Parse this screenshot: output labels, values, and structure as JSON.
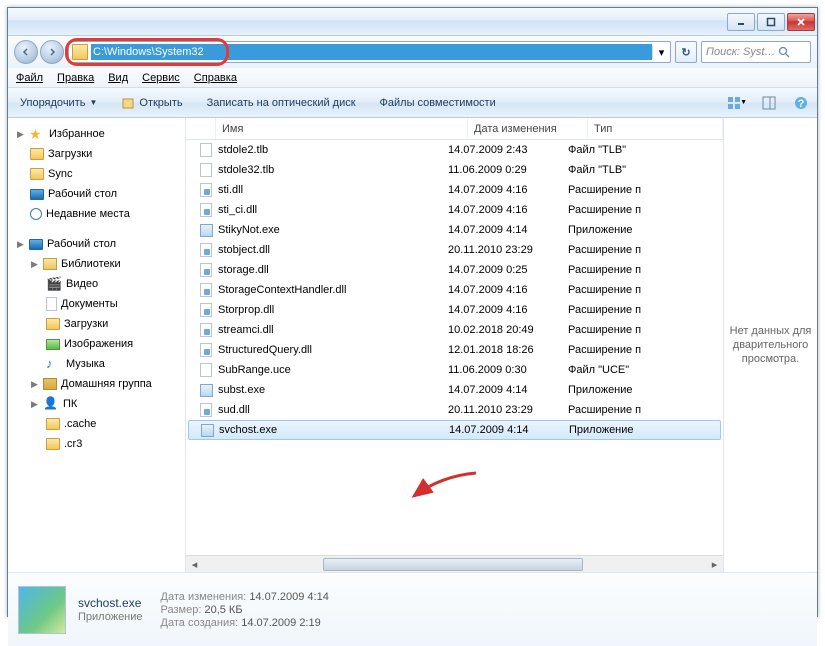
{
  "address_path": "C:\\Windows\\System32",
  "search_placeholder": "Поиск: Syst…",
  "menubar": [
    "Файл",
    "Правка",
    "Вид",
    "Сервис",
    "Справка"
  ],
  "toolbar": {
    "organize": "Упорядочить",
    "open": "Открыть",
    "burn": "Записать на оптический диск",
    "compat": "Файлы совместимости"
  },
  "sidebar": {
    "favorites": "Избранное",
    "downloads": "Загрузки",
    "sync": "Sync",
    "desktop": "Рабочий стол",
    "recent": "Недавние места",
    "desktop2": "Рабочий стол",
    "libraries": "Библиотеки",
    "video": "Видео",
    "documents": "Документы",
    "downloads2": "Загрузки",
    "images": "Изображения",
    "music": "Музыка",
    "homegroup": "Домашняя группа",
    "pc": "ПК",
    "cache": ".cache",
    "cr3": ".cr3"
  },
  "columns": {
    "name": "Имя",
    "date": "Дата изменения",
    "type": "Тип"
  },
  "files": [
    {
      "icon": "tlb",
      "name": "stdole2.tlb",
      "date": "14.07.2009 2:43",
      "type": "Файл \"TLB\""
    },
    {
      "icon": "tlb",
      "name": "stdole32.tlb",
      "date": "11.06.2009 0:29",
      "type": "Файл \"TLB\""
    },
    {
      "icon": "dll",
      "name": "sti.dll",
      "date": "14.07.2009 4:16",
      "type": "Расширение п"
    },
    {
      "icon": "dll",
      "name": "sti_ci.dll",
      "date": "14.07.2009 4:16",
      "type": "Расширение п"
    },
    {
      "icon": "exe",
      "name": "StikyNot.exe",
      "date": "14.07.2009 4:14",
      "type": "Приложение"
    },
    {
      "icon": "dll",
      "name": "stobject.dll",
      "date": "20.11.2010 23:29",
      "type": "Расширение п"
    },
    {
      "icon": "dll",
      "name": "storage.dll",
      "date": "14.07.2009 0:25",
      "type": "Расширение п"
    },
    {
      "icon": "dll",
      "name": "StorageContextHandler.dll",
      "date": "14.07.2009 4:16",
      "type": "Расширение п"
    },
    {
      "icon": "dll",
      "name": "Storprop.dll",
      "date": "14.07.2009 4:16",
      "type": "Расширение п"
    },
    {
      "icon": "dll",
      "name": "streamci.dll",
      "date": "10.02.2018 20:49",
      "type": "Расширение п"
    },
    {
      "icon": "dll",
      "name": "StructuredQuery.dll",
      "date": "12.01.2018 18:26",
      "type": "Расширение п"
    },
    {
      "icon": "tlb",
      "name": "SubRange.uce",
      "date": "11.06.2009 0:30",
      "type": "Файл \"UCE\""
    },
    {
      "icon": "exe",
      "name": "subst.exe",
      "date": "14.07.2009 4:14",
      "type": "Приложение"
    },
    {
      "icon": "dll",
      "name": "sud.dll",
      "date": "20.11.2010 23:29",
      "type": "Расширение п"
    },
    {
      "icon": "exe",
      "name": "svchost.exe",
      "date": "14.07.2009 4:14",
      "type": "Приложение",
      "selected": true
    }
  ],
  "preview_text": "Нет данных для дварительного просмотра.",
  "details": {
    "filename": "svchost.exe",
    "filetype": "Приложение",
    "mod_label": "Дата изменения:",
    "mod_value": "14.07.2009 4:14",
    "size_label": "Размер:",
    "size_value": "20,5 КБ",
    "created_label": "Дата создания:",
    "created_value": "14.07.2009 2:19"
  }
}
